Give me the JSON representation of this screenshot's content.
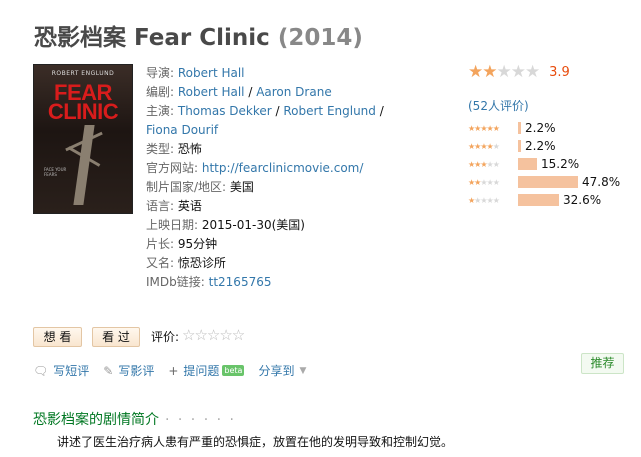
{
  "title": {
    "main": "恐影档案 Fear Clinic",
    "year": "(2014)"
  },
  "poster": {
    "top_name": "ROBERT ENGLUND",
    "title_line1": "FEAR",
    "title_line2": "CLINIC",
    "tagline": "FACE YOUR FEARS"
  },
  "info": {
    "director_label": "导演:",
    "director": "Robert Hall",
    "writer_label": "编剧:",
    "writer1": "Robert Hall",
    "sep": " / ",
    "writer2": "Aaron Drane",
    "cast_label": "主演:",
    "cast1": "Thomas Dekker",
    "cast2": "Robert Englund",
    "cast3": "Fiona Dourif",
    "genre_label": "类型:",
    "genre": "恐怖",
    "site_label": "官方网站:",
    "site": "http://fearclinicmovie.com/",
    "country_label": "制片国家/地区:",
    "country": "美国",
    "lang_label": "语言:",
    "lang": "英语",
    "date_label": "上映日期:",
    "date": "2015-01-30(美国)",
    "runtime_label": "片长:",
    "runtime": "95分钟",
    "aka_label": "又名:",
    "aka": "惊恐诊所",
    "imdb_label": "IMDb链接:",
    "imdb": "tt2165765"
  },
  "rating": {
    "score": "3.9",
    "stars_filled": 2,
    "count": "(52人评价)",
    "histogram": [
      {
        "stars": 5,
        "pct_label": "2.2%",
        "pct": 2.2
      },
      {
        "stars": 4,
        "pct_label": "2.2%",
        "pct": 2.2
      },
      {
        "stars": 3,
        "pct_label": "15.2%",
        "pct": 15.2
      },
      {
        "stars": 2,
        "pct_label": "47.8%",
        "pct": 47.8
      },
      {
        "stars": 1,
        "pct_label": "32.6%",
        "pct": 32.6
      }
    ]
  },
  "buttons": {
    "want": "想 看",
    "seen": "看 过",
    "rate_label": "评价:"
  },
  "actions": {
    "short_review": "写短评",
    "review": "写影评",
    "question": "提问题",
    "beta": "beta",
    "share": "分享到",
    "recommend": "推荐"
  },
  "plot": {
    "title": "恐影档案的剧情简介",
    "dots": "· · · · · ·",
    "summary": "讲述了医生治疗病人患有严重的恐惧症，放置在他的发明导致和控制幻觉。",
    "cut": "　　"
  },
  "colors": {
    "link": "#3377aa",
    "score": "#e84c0d",
    "star": "#f3a45d",
    "bar": "#f5c29e",
    "section": "#007722"
  }
}
